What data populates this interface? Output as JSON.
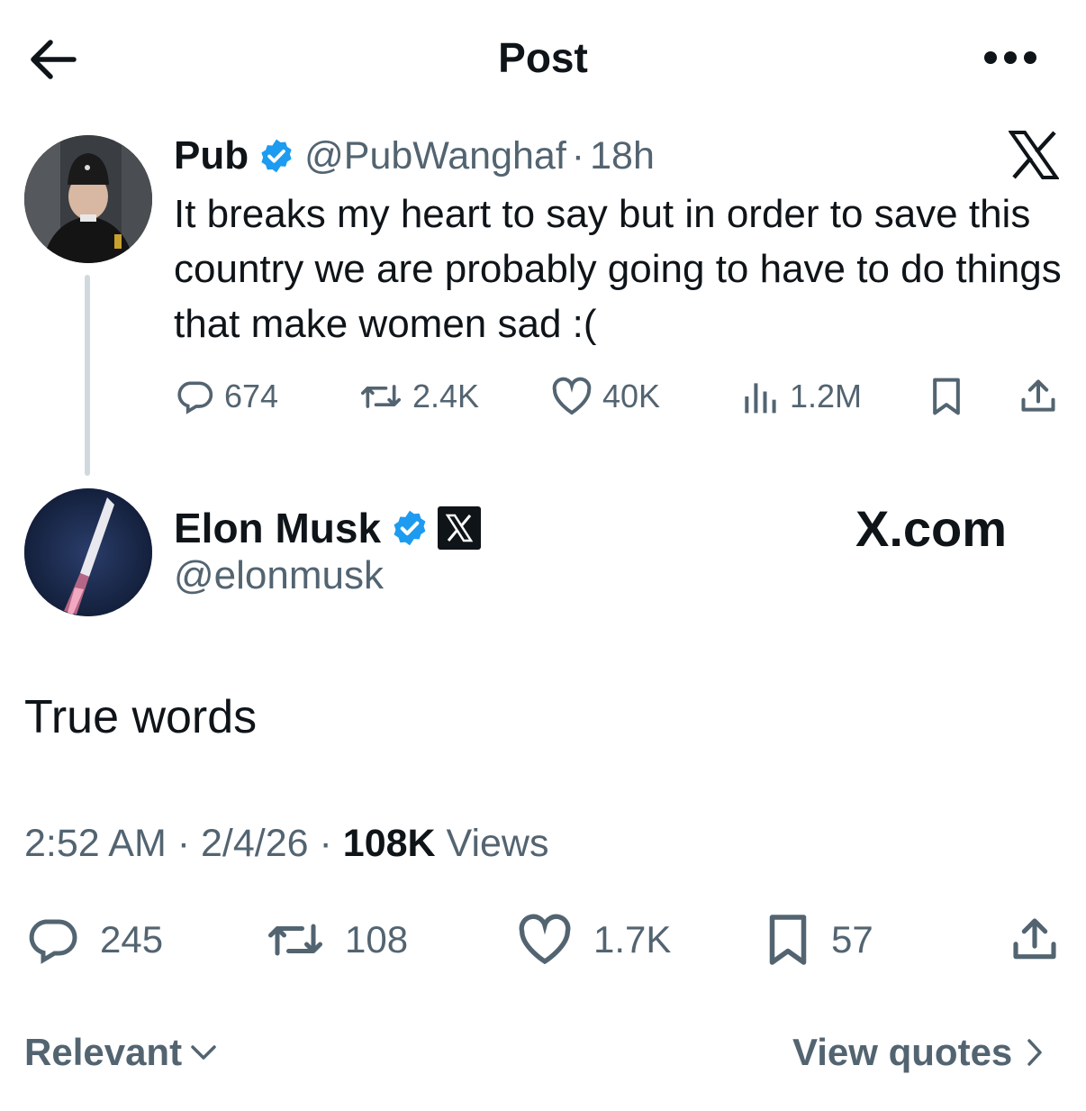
{
  "header": {
    "title": "Post"
  },
  "parent_post": {
    "name": "Pub",
    "handle": "@PubWanghaf",
    "time": "18h",
    "text": "It breaks my heart to say but in order to save this country we are probably going to have to do things that make women sad :(",
    "stats": {
      "replies": "674",
      "reposts": "2.4K",
      "likes": "40K",
      "views": "1.2M"
    }
  },
  "reply_post": {
    "name": "Elon Musk",
    "handle": "@elonmusk",
    "affiliation": "X.com",
    "text": "True words",
    "time": "2:52 AM",
    "date": "2/4/26",
    "views_count": "108K",
    "views_label": "Views",
    "stats": {
      "replies": "245",
      "reposts": "108",
      "likes": "1.7K",
      "bookmarks": "57"
    }
  },
  "footer": {
    "sort_label": "Relevant",
    "view_quotes_label": "View quotes"
  },
  "colors": {
    "text": "#0f1419",
    "secondary": "#536471",
    "verified": "#1d9bf0",
    "thread_line": "#cfd9de"
  }
}
